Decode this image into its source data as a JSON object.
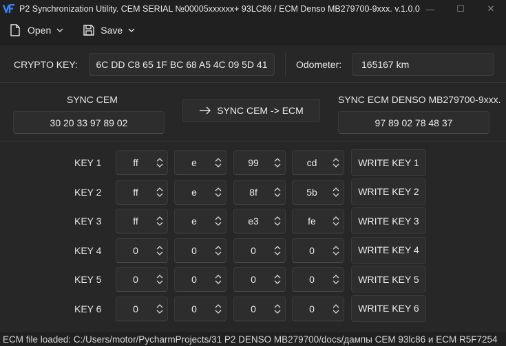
{
  "window": {
    "title": "P2 Synchronization Utility. CEM SERIAL №00005xxxxxx+ 93LC86 / ECM Denso MB279700-9xxx. v.1.0.0",
    "minimize": "—",
    "maximize": "☐",
    "close": "✕"
  },
  "menu": {
    "open_label": "Open",
    "save_label": "Save"
  },
  "crypto": {
    "label": "CRYPTO KEY:",
    "value": "6C DD C8 65 1F BC 68 A5 4C 09 5D 41"
  },
  "odometer": {
    "label": "Odometer:",
    "value": "165167 km"
  },
  "sync": {
    "cem_label": "SYNC CEM",
    "cem_value": "30 20 33 97 89 02",
    "button_label": "SYNC CEM -> ECM",
    "ecm_label": "SYNC ECM DENSO MB279700-9xxx.",
    "ecm_value": "97 89 02 78 48 37"
  },
  "keys": [
    {
      "label": "KEY 1",
      "values": [
        "ff",
        "e",
        "99",
        "cd"
      ],
      "write_label": "WRITE KEY 1"
    },
    {
      "label": "KEY 2",
      "values": [
        "ff",
        "e",
        "8f",
        "5b"
      ],
      "write_label": "WRITE KEY 2"
    },
    {
      "label": "KEY 3",
      "values": [
        "ff",
        "e",
        "e3",
        "fe"
      ],
      "write_label": "WRITE KEY 3"
    },
    {
      "label": "KEY 4",
      "values": [
        "0",
        "0",
        "0",
        "0"
      ],
      "write_label": "WRITE KEY 4"
    },
    {
      "label": "KEY 5",
      "values": [
        "0",
        "0",
        "0",
        "0"
      ],
      "write_label": "WRITE KEY 5"
    },
    {
      "label": "KEY 6",
      "values": [
        "0",
        "0",
        "0",
        "0"
      ],
      "write_label": "WRITE KEY 6"
    }
  ],
  "status": {
    "text": "ECM file loaded: C:/Users/motor/PycharmProjects/31 P2 DENSO MB279700/docs/дампы CEM 93lc86 и ECM R5F7254"
  },
  "colors": {
    "accent": "#3b82f6",
    "background": "#202020",
    "panel": "#272727"
  }
}
